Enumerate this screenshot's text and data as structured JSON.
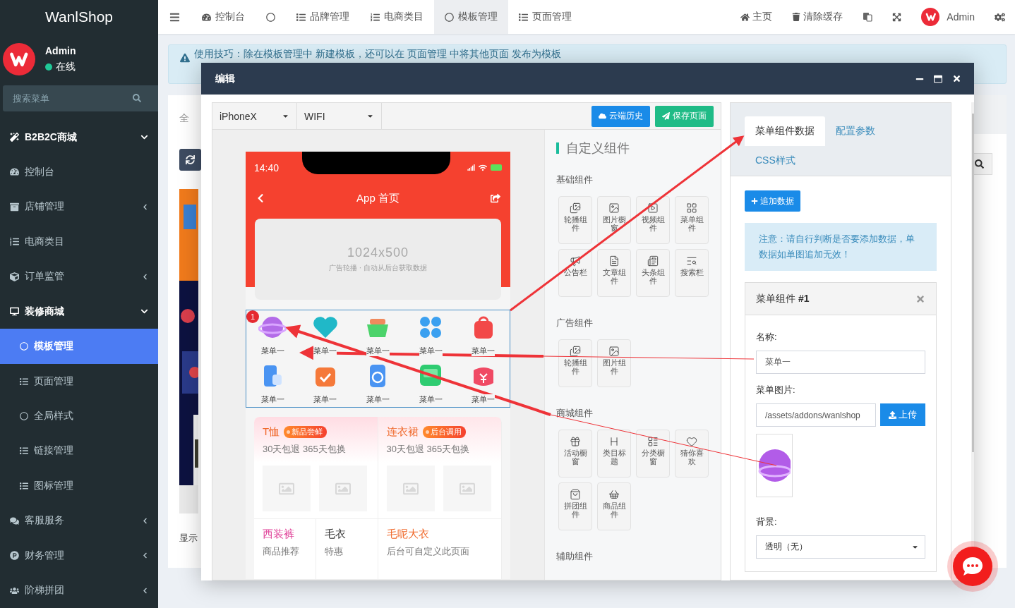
{
  "sidebar": {
    "logo": "WanlShop",
    "user": {
      "name": "Admin",
      "status": "在线"
    },
    "search": {
      "placeholder": "搜索菜单"
    },
    "items": [
      {
        "label": "B2B2C商城",
        "kind": "module",
        "expanded": true
      },
      {
        "label": "控制台",
        "kind": "link"
      },
      {
        "label": "店铺管理",
        "kind": "menu",
        "expanded": false
      },
      {
        "label": "电商类目",
        "kind": "link"
      },
      {
        "label": "订单监管",
        "kind": "menu",
        "expanded": false
      },
      {
        "label": "装修商城",
        "kind": "menu",
        "expanded": true,
        "children": [
          {
            "label": "模板管理",
            "selected": true
          },
          {
            "label": "页面管理",
            "selected": false
          },
          {
            "label": "全局样式",
            "selected": false
          },
          {
            "label": "链接管理",
            "selected": false
          },
          {
            "label": "图标管理",
            "selected": false
          }
        ]
      },
      {
        "label": "客服服务",
        "kind": "menu",
        "expanded": false
      },
      {
        "label": "财务管理",
        "kind": "menu",
        "expanded": false
      },
      {
        "label": "阶梯拼团",
        "kind": "menu",
        "expanded": false
      }
    ]
  },
  "topbar": {
    "tabs": [
      {
        "kind": "text",
        "label": "控制台",
        "selected": false
      },
      {
        "kind": "icon",
        "selected": false
      },
      {
        "kind": "text",
        "label": "品牌管理",
        "selected": false
      },
      {
        "kind": "text",
        "label": "电商类目",
        "selected": false
      },
      {
        "kind": "text",
        "label": "模板管理",
        "selected": true
      },
      {
        "kind": "text",
        "label": "页面管理",
        "selected": false
      }
    ],
    "links": [
      "主页",
      "清除缓存"
    ],
    "user": "Admin"
  },
  "background": {
    "tip": "使用技巧：除在模板管理中 新建模板，还可以在 页面管理 中将其他页面 发布为模板",
    "tab": "全",
    "footer": "显示"
  },
  "modal": {
    "title": "编辑",
    "editor": {
      "device": "iPhoneX",
      "network": "WIFI",
      "buttons": [
        {
          "kind": "cloud",
          "label": "云端历史"
        },
        {
          "kind": "save",
          "label": "保存页面"
        }
      ]
    },
    "phone": {
      "time": "14:40",
      "title": "App 首页",
      "banner": "1024x500",
      "banner_caption": "广告轮播 · 自动从后台获取数据",
      "badge": "1",
      "menu": [
        "菜单一",
        "菜单一",
        "菜单一",
        "菜单一",
        "菜单一",
        "菜单一",
        "菜单一",
        "菜单一",
        "菜单一",
        "菜单一"
      ],
      "cards": [
        {
          "title": "T恤",
          "tag": "新品尝鲜",
          "subtitle": "30天包退 365天包换"
        },
        {
          "title": "连衣裙",
          "tag": "后台调用",
          "subtitle": "30天包退 365天包换"
        }
      ],
      "promos": [
        {
          "title": "西装裤",
          "subtitle": "商品推荐",
          "color": "#e04399"
        },
        {
          "title": "毛衣",
          "subtitle": "特惠",
          "color": "#333333"
        },
        {
          "title": "毛呢大衣",
          "subtitle": "后台可自定义此页面",
          "color": "#f06a2c"
        }
      ]
    },
    "palette": {
      "title": "自定义组件",
      "sections": [
        {
          "title": "基础组件",
          "items": [
            "轮播组件",
            "图片橱窗",
            "视频组件",
            "菜单组件",
            "公告栏",
            "文章组件",
            "头条组件",
            "搜索栏"
          ]
        },
        {
          "title": "广告组件",
          "items": [
            "轮播组件",
            "图片组件"
          ]
        },
        {
          "title": "商城组件",
          "items": [
            "活动橱窗",
            "类目标题",
            "分类橱窗",
            "猜你喜欢",
            "拼团组件",
            "商品组件"
          ]
        },
        {
          "title": "辅助组件"
        }
      ]
    },
    "settings": {
      "tabs": [
        {
          "label": "菜单组件数据",
          "selected": true
        },
        {
          "label": "配置参数",
          "selected": false
        },
        {
          "label": "CSS样式",
          "selected": false
        }
      ],
      "add_button": "追加数据",
      "note": "注意：请自行判断是否要添加数据，单数据如单图追加无效！",
      "item": {
        "title": "菜单组件 **#1**",
        "name_label": "名称:",
        "name_value": "菜单一",
        "image_label": "菜单图片:",
        "image_value": "/assets/addons/wanlshop",
        "upload": "上传",
        "bg_label": "背景:",
        "bg_value": "透明（无）"
      }
    }
  }
}
